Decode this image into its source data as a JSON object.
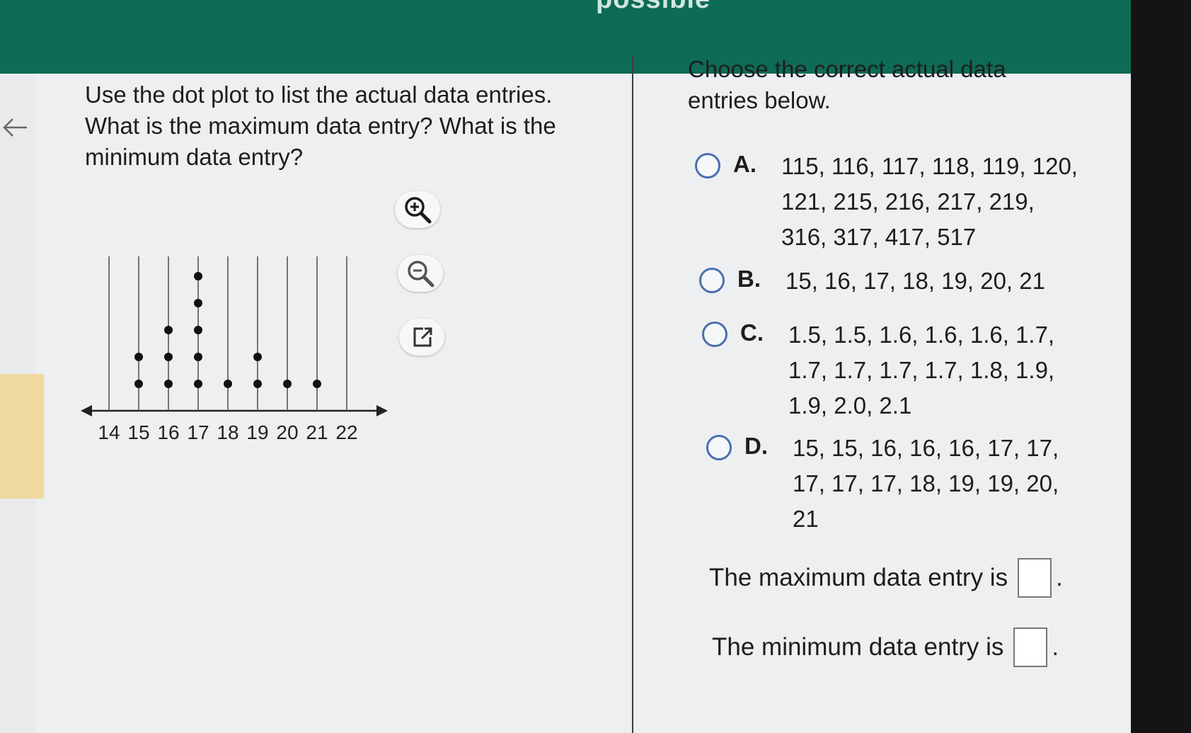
{
  "header": {
    "partial_text": "possible"
  },
  "question": {
    "text": "Use the dot plot to list the actual data entries. What is the maximum data entry? What is the minimum data entry?"
  },
  "tools": {
    "zoom_in_icon": "zoom-in-icon",
    "zoom_out_icon": "zoom-out-icon",
    "popout_icon": "external-link-icon"
  },
  "chart_data": {
    "type": "scatter",
    "title": "",
    "xlabel": "",
    "ylabel": "",
    "categories": [
      "14",
      "15",
      "16",
      "17",
      "18",
      "19",
      "20",
      "21",
      "22"
    ],
    "counts": [
      0,
      2,
      3,
      5,
      1,
      2,
      1,
      1,
      0
    ],
    "xlim": [
      14,
      22
    ]
  },
  "right": {
    "title": "Choose the correct actual data entries below.",
    "options": [
      {
        "letter": "A.",
        "text": "115, 116, 117, 118, 119, 120, 121, 215, 216, 217, 219, 316, 317, 417, 517"
      },
      {
        "letter": "B.",
        "text": "15, 16, 17, 18, 19, 20, 21"
      },
      {
        "letter": "C.",
        "text": "1.5, 1.5, 1.6, 1.6, 1.6, 1.7, 1.7, 1.7, 1.7, 1.7, 1.8, 1.9, 1.9, 2.0, 2.1"
      },
      {
        "letter": "D.",
        "text": "15, 15, 16, 16, 16, 17, 17, 17, 17, 17, 18, 19, 19, 20, 21"
      }
    ],
    "max_label": "The maximum data entry is",
    "min_label": "The minimum data entry is",
    "period": "."
  },
  "colors": {
    "header": "#0e6b55",
    "radio": "#4a6fae"
  }
}
